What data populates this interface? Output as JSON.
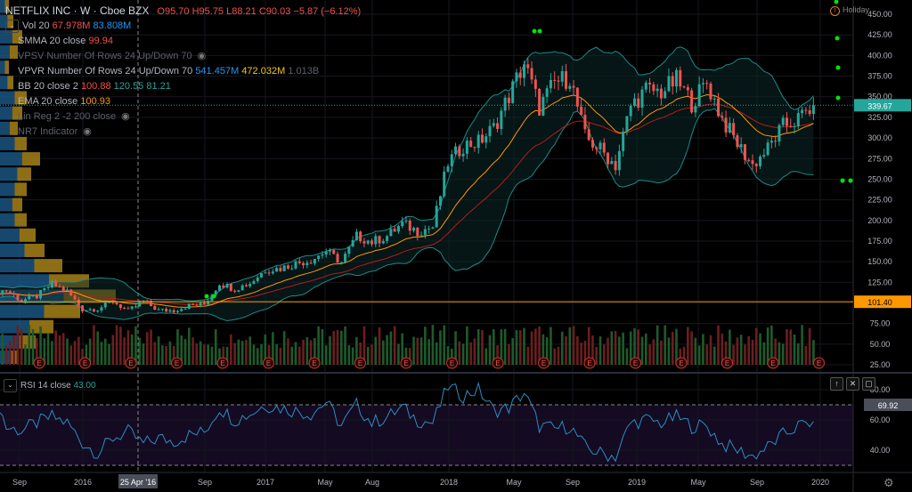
{
  "header": {
    "symbol": "NETFLIX INC · W · Cboe BZX",
    "open": "O95.70",
    "high": "H95.75",
    "low": "L88.21",
    "close": "C90.03",
    "change": "−5.87 (−6.12%)"
  },
  "indicators": [
    {
      "name": "Vol 20",
      "values": [
        "67.978M",
        "83.808M"
      ]
    },
    {
      "name": "SMMA 20 close",
      "values": [
        "99.94"
      ]
    },
    {
      "name": "VPSV Number Of Rows 24 Up/Down 70",
      "values": [],
      "hidden": true
    },
    {
      "name": "VPVR Number Of Rows 24 Up/Down 70",
      "values": [
        "541.457M",
        "472.032M",
        "1.013B"
      ]
    },
    {
      "name": "BB 20 close 2",
      "values": [
        "100.88",
        "120.55",
        "81.21"
      ]
    },
    {
      "name": "EMA 20 close",
      "values": [
        "100.93"
      ]
    },
    {
      "name": "Lin Reg 2 -2 200 close",
      "values": [],
      "hidden": true
    },
    {
      "name": "NR7 Indicator",
      "values": [],
      "hidden": true
    }
  ],
  "holiday_label": "Holiday",
  "rsi": {
    "label": "RSI 14 close",
    "value": "43.00",
    "level_label": "69.92"
  },
  "price_axis": {
    "ticks": [
      "450.00",
      "425.00",
      "400.00",
      "375.00",
      "350.00",
      "325.00",
      "300.00",
      "275.00",
      "250.00",
      "225.00",
      "200.00",
      "175.00",
      "150.00",
      "125.00",
      "100.00",
      "75.00",
      "50.00",
      "25.00"
    ],
    "last_price": "339.67",
    "crosshair_price": "101.40"
  },
  "rsi_axis": {
    "ticks": [
      "80.00",
      "60.00",
      "40.00"
    ]
  },
  "time_axis": {
    "ticks": [
      "Sep",
      "2016",
      "Sep",
      "2017",
      "May",
      "Aug",
      "2018",
      "May",
      "Sep",
      "2019",
      "May",
      "Sep",
      "2020"
    ],
    "crosshair_date": "25 Apr '16"
  },
  "colors": {
    "up": "#26a69a",
    "down": "#ef5350",
    "ema": "#ff9800",
    "smma": "#b71c1c",
    "bb": "#1d8a8a",
    "rsi": "#2e8cc0",
    "crosshair": "#ff9800"
  },
  "chart_data": {
    "type": "candlestick",
    "interval": "weekly",
    "start_month": "2015-07",
    "monthly_close": [
      114,
      115,
      103,
      108,
      123,
      114,
      92,
      93,
      102,
      90,
      102,
      91,
      91,
      97,
      98,
      124,
      117,
      124,
      140,
      142,
      148,
      152,
      163,
      149,
      181,
      174,
      181,
      196,
      187,
      192,
      270,
      291,
      295,
      312,
      351,
      391,
      337,
      367,
      374,
      301,
      286,
      267,
      339,
      358,
      356,
      370,
      343,
      367,
      323,
      293,
      267,
      287,
      314,
      323,
      339.67
    ],
    "rsi_monthly": [
      85,
      55,
      53,
      58,
      62,
      58,
      45,
      38,
      48,
      52,
      44,
      48,
      46,
      50,
      52,
      68,
      60,
      64,
      70,
      68,
      66,
      64,
      72,
      56,
      70,
      58,
      62,
      68,
      60,
      58,
      82,
      76,
      80,
      66,
      68,
      78,
      56,
      54,
      56,
      42,
      38,
      36,
      58,
      60,
      58,
      62,
      56,
      56,
      44,
      40,
      36,
      42,
      50,
      56,
      59
    ],
    "ylim": [
      15,
      460
    ],
    "rsi_levels": [
      70,
      30
    ]
  }
}
